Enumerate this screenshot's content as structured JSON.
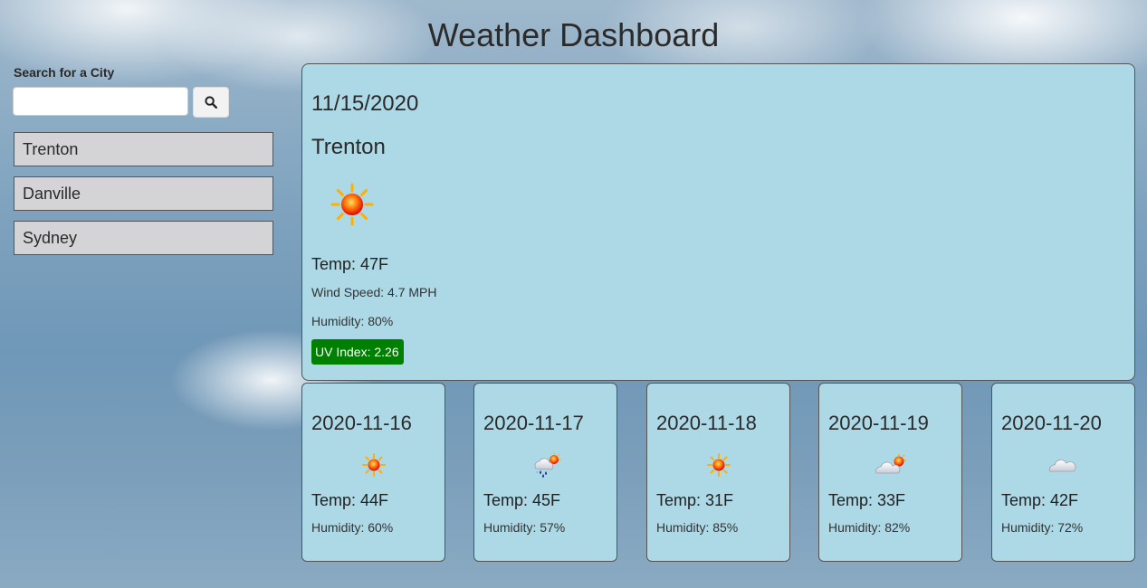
{
  "header": {
    "title": "Weather Dashboard"
  },
  "search": {
    "label": "Search for a City",
    "value": "",
    "placeholder": "",
    "button_icon": "search-icon"
  },
  "history": [
    {
      "label": "Trenton"
    },
    {
      "label": "Danville"
    },
    {
      "label": "Sydney"
    }
  ],
  "current": {
    "date": "11/15/2020",
    "city": "Trenton",
    "icon": "sun-icon",
    "temp": "Temp: 47F",
    "wind": "Wind Speed: 4.7 MPH",
    "humidity": "Humidity: 80%",
    "uv": "UV Index: 2.26",
    "uv_color": "#008000"
  },
  "forecast": [
    {
      "date": "2020-11-16",
      "icon": "sun-icon",
      "temp": "Temp: 44F",
      "humidity": "Humidity: 60%"
    },
    {
      "date": "2020-11-17",
      "icon": "rain-snow-sun-icon",
      "temp": "Temp: 45F",
      "humidity": "Humidity: 57%"
    },
    {
      "date": "2020-11-18",
      "icon": "sun-icon",
      "temp": "Temp: 31F",
      "humidity": "Humidity: 85%"
    },
    {
      "date": "2020-11-19",
      "icon": "partly-cloudy-icon",
      "temp": "Temp: 33F",
      "humidity": "Humidity: 82%"
    },
    {
      "date": "2020-11-20",
      "icon": "cloud-icon",
      "temp": "Temp: 42F",
      "humidity": "Humidity: 72%"
    }
  ],
  "colors": {
    "card_bg": "#add8e6",
    "history_bg": "#d4d4d6",
    "uv_ok": "#008000"
  }
}
